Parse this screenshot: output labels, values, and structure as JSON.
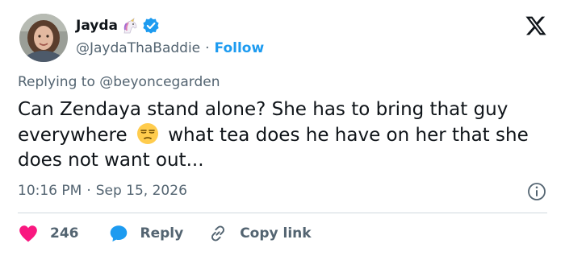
{
  "author": {
    "name": "Jayda",
    "handle": "@JaydaThaBaddie",
    "follow_label": "Follow"
  },
  "dot": "·",
  "replying": {
    "prefix": "Replying to ",
    "mention": "@beyoncegarden"
  },
  "tweet": {
    "line_part1": "Can Zendaya stand alone? She has to bring that guy everywhere",
    "line_part2": "what tea does he have on her that she does not want out..."
  },
  "meta": {
    "time": "10:16 PM",
    "date": "Sep 15, 2026"
  },
  "actions": {
    "likes": "246",
    "reply": "Reply",
    "copy_link": "Copy link"
  },
  "colors": {
    "text": "#0f1419",
    "secondary": "#536471",
    "accent": "#1d9bf0",
    "like": "#f91880",
    "divider": "#cfd9de"
  },
  "icons": [
    "avatar",
    "unicorn-icon",
    "verified-icon",
    "x-logo-icon",
    "unamused-emoji-icon",
    "info-icon",
    "heart-icon",
    "reply-bubble-icon",
    "link-icon"
  ]
}
